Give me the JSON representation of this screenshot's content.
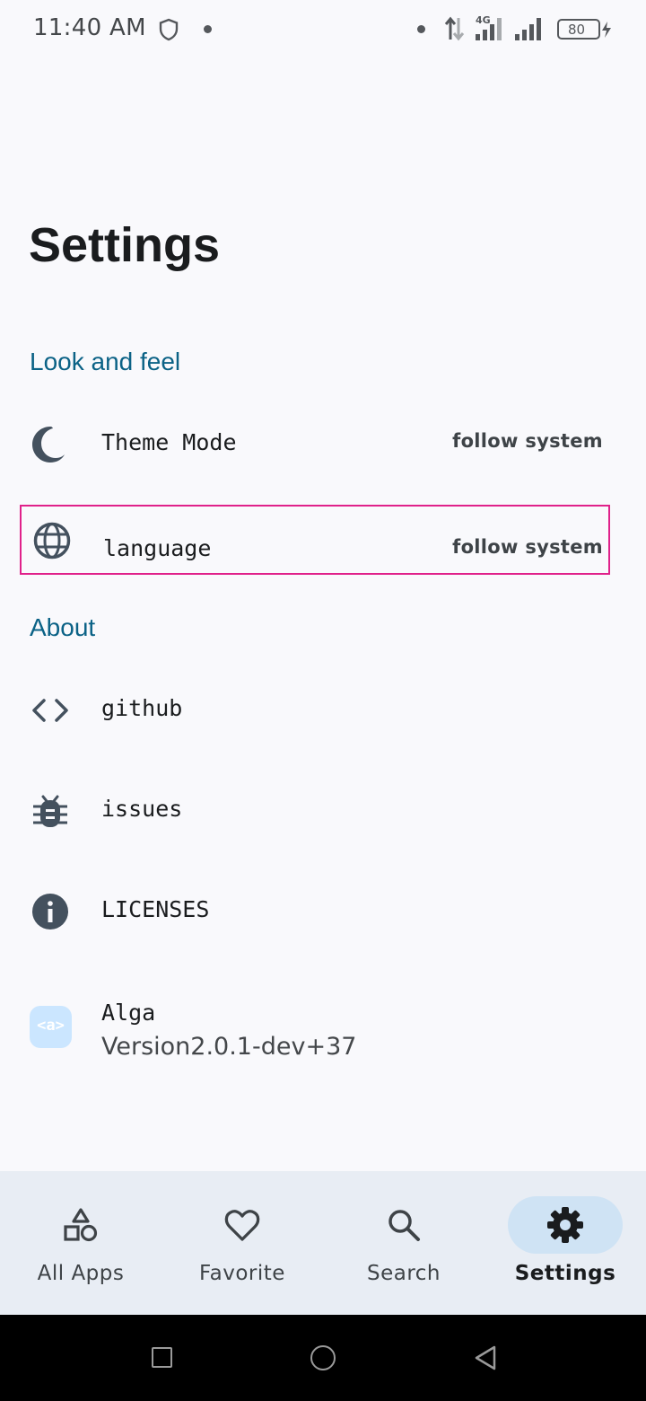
{
  "status_bar": {
    "time": "11:40 AM",
    "network_type": "4G",
    "battery_level": "80",
    "icons": [
      "shield-icon",
      "dot-icon",
      "data-transfer-icon",
      "signal-4g-icon",
      "signal-icon",
      "battery-icon",
      "charging-icon"
    ]
  },
  "page": {
    "title": "Settings"
  },
  "sections": {
    "look_and_feel": {
      "header": "Look and feel",
      "theme_mode": {
        "label": "Theme Mode",
        "value": "follow system",
        "icon": "moon-icon"
      },
      "language": {
        "label": "language",
        "value": "follow system",
        "icon": "globe-icon"
      }
    },
    "about": {
      "header": "About",
      "github": {
        "label": "github",
        "icon": "code-icon"
      },
      "issues": {
        "label": "issues",
        "icon": "bug-icon"
      },
      "licenses": {
        "label": "LICENSES",
        "icon": "info-icon"
      },
      "app": {
        "name": "Alga",
        "version": "Version2.0.1-dev+37",
        "logo_text": "<a>"
      }
    }
  },
  "bottom_nav": {
    "items": [
      {
        "label": "All Apps",
        "icon": "shapes-icon",
        "active": false
      },
      {
        "label": "Favorite",
        "icon": "heart-icon",
        "active": false
      },
      {
        "label": "Search",
        "icon": "search-icon",
        "active": false
      },
      {
        "label": "Settings",
        "icon": "gear-icon",
        "active": true
      }
    ]
  },
  "colors": {
    "background": "#f9f9fc",
    "accent": "#0b6286",
    "icon": "#44515e",
    "nav_background": "#e8edf4",
    "nav_active_pill": "#cfe3f4",
    "highlight_border": "#e0218a"
  }
}
